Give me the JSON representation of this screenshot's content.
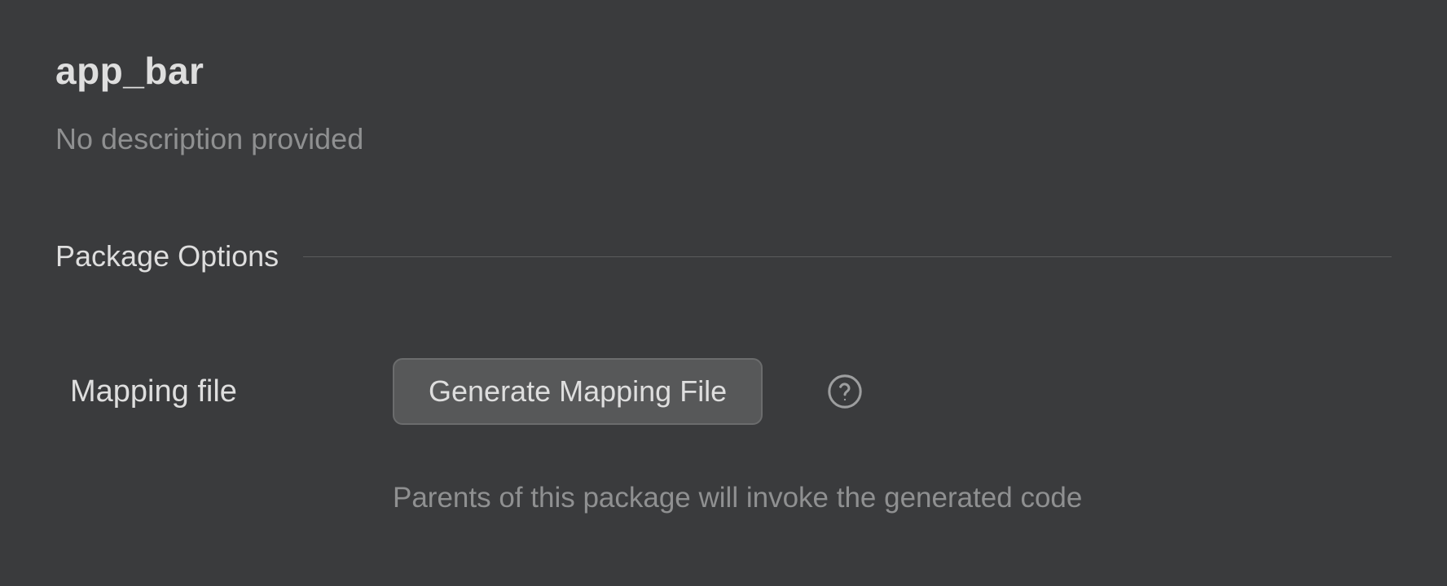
{
  "package": {
    "title": "app_bar",
    "description": "No description provided"
  },
  "section": {
    "title": "Package Options"
  },
  "options": {
    "mapping_file": {
      "label": "Mapping file",
      "button_label": "Generate Mapping File",
      "hint": "Parents of this package will invoke the generated code"
    }
  }
}
